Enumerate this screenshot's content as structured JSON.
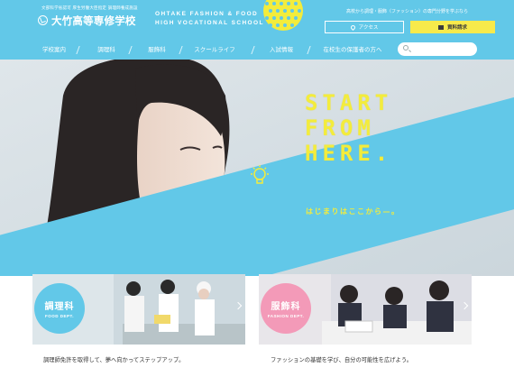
{
  "brand": {
    "accreditation": "文部科学省認可 厚生労働大臣指定 調理師養成施設",
    "name": "大竹高等専修学校"
  },
  "tagline": {
    "line1": "OHTAKE FASHION & FOOD",
    "line2": "HIGH VOCATIONAL SCHOOL"
  },
  "header": {
    "description": "高校から調理・服飾（ファッション）の専門分野を学ぶなら",
    "access_label": "アクセス",
    "request_label": "資料請求"
  },
  "nav": {
    "items": [
      {
        "label": "学校案内"
      },
      {
        "label": "調理科"
      },
      {
        "label": "服飾科"
      },
      {
        "label": "スクールライフ"
      },
      {
        "label": "入試情報"
      },
      {
        "label": "在校生の保護者の方へ"
      }
    ],
    "search_placeholder": ""
  },
  "hero": {
    "headline": "START\nFROM\nHERE.",
    "subtext": "はじまりはここから—。"
  },
  "departments": [
    {
      "name": "調理科",
      "english": "FOOD DEPT.",
      "caption": "調理師免許を取得して、夢へ向かってステップアップ。",
      "color": "#62c8e8"
    },
    {
      "name": "服飾科",
      "english": "FASHION DEPT.",
      "caption": "ファッションの基礎を学び、自分の可能性を広げよう。",
      "color": "#f39ab8"
    }
  ],
  "colors": {
    "brand_blue": "#62c8e8",
    "accent_yellow": "#f3ec3c",
    "pink": "#f39ab8"
  }
}
